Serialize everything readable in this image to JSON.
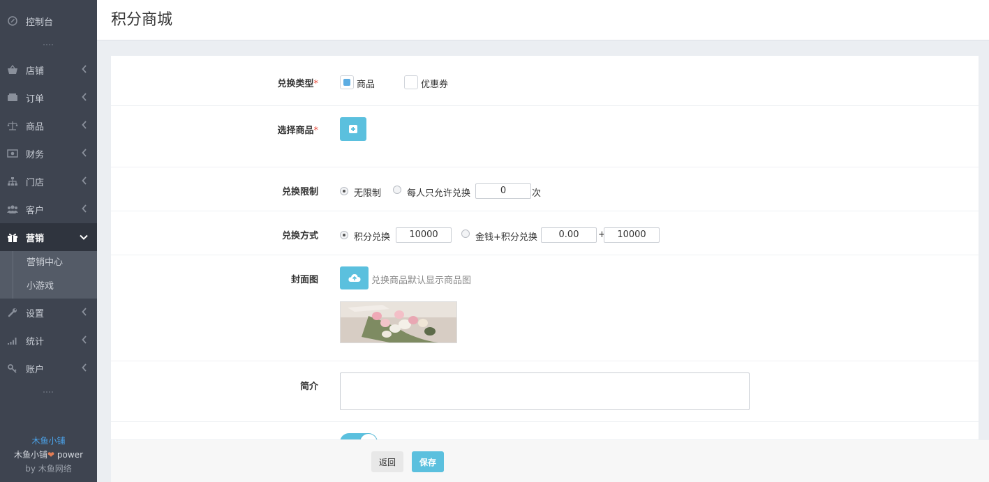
{
  "sidebar": {
    "dashboard": {
      "label": "控制台",
      "icon": "dashboard-icon"
    },
    "items": [
      {
        "label": "店铺",
        "icon": "basket-icon"
      },
      {
        "label": "订单",
        "icon": "order-icon"
      },
      {
        "label": "商品",
        "icon": "scale-icon"
      },
      {
        "label": "财务",
        "icon": "money-icon"
      },
      {
        "label": "门店",
        "icon": "sitemap-icon"
      },
      {
        "label": "客户",
        "icon": "users-icon"
      },
      {
        "label": "营销",
        "icon": "gift-icon",
        "active": true
      },
      {
        "label": "设置",
        "icon": "wrench-icon"
      },
      {
        "label": "统计",
        "icon": "signal-icon"
      },
      {
        "label": "账户",
        "icon": "key-icon"
      }
    ],
    "sub_items": [
      {
        "label": "营销中心"
      },
      {
        "label": "小游戏"
      }
    ],
    "brand": {
      "name": "木鱼小铺",
      "power_prefix": "木鱼小铺",
      "power_suffix": "power",
      "by_prefix": "by",
      "by_name": "木鱼网络"
    }
  },
  "header": {
    "title": "积分商城"
  },
  "form": {
    "exchange_type": {
      "label": "兑换类型",
      "options": [
        {
          "label": "商品",
          "checked": true
        },
        {
          "label": "优惠券",
          "checked": false
        }
      ]
    },
    "select_goods": {
      "label": "选择商品"
    },
    "limit": {
      "label": "兑换限制",
      "option_unlimited": "无限制",
      "option_per_person": "每人只允许兑换",
      "per_person_value": "0",
      "unit": "次",
      "selected": "unlimited"
    },
    "method": {
      "label": "兑换方式",
      "option_points": "积分兑换",
      "points_value": "10000",
      "option_money_points": "金钱+积分兑换",
      "money_value": "0.00",
      "plus": "+",
      "money_points_value": "10000",
      "selected": "points"
    },
    "cover": {
      "label": "封面图",
      "hint": "兑换商品默认显示商品图"
    },
    "intro": {
      "label": "简介",
      "value": ""
    },
    "status_toggle": {
      "on": true
    }
  },
  "footer": {
    "back_label": "返回",
    "save_label": "保存"
  },
  "colors": {
    "sidebar_bg": "#3e4450",
    "accent_teal": "#5bc0de",
    "checkbox_blue": "#5dade2",
    "required_red": "#e74c3c",
    "brand_blue": "#4ba3ea"
  }
}
